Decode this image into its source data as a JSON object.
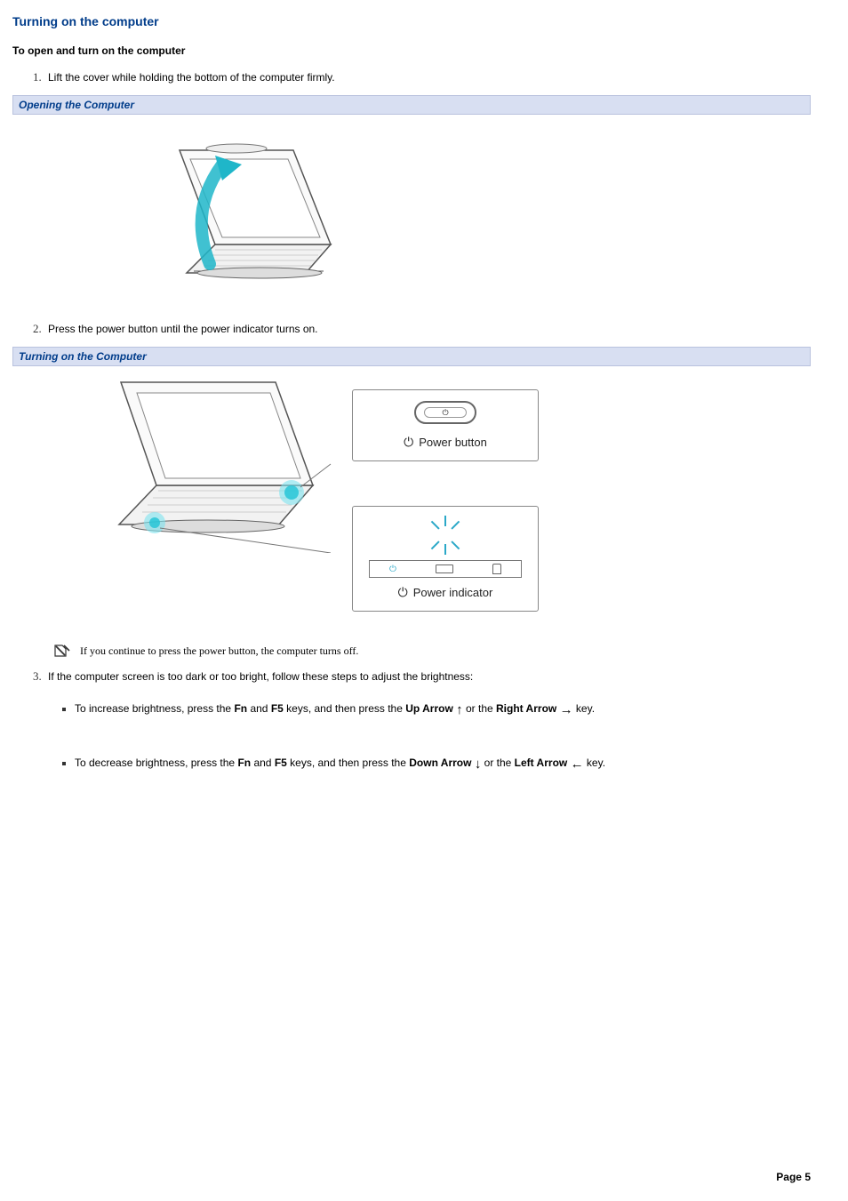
{
  "heading": "Turning on the computer",
  "subheading": "To open and turn on the computer",
  "steps": {
    "s1": "Lift the cover while holding the bottom of the computer firmly.",
    "s2": "Press the power button until the power indicator turns on.",
    "s3": "If the computer screen is too dark or too bright, follow these steps to adjust the brightness:"
  },
  "captions": {
    "open": "Opening the Computer",
    "turnon": "Turning on the Computer"
  },
  "callouts": {
    "power_button": "Power button",
    "power_indicator": "Power indicator"
  },
  "note": "If you continue to press the power button, the computer turns off.",
  "bullets": {
    "increase": {
      "pre": "To increase brightness, press the ",
      "fn": "Fn",
      "mid1": " and ",
      "f5": "F5",
      "mid2": " keys, and then press the ",
      "uparrow": "Up Arrow",
      "or": " or the ",
      "rightarrow": "Right Arrow",
      "post": " key."
    },
    "decrease": {
      "pre": "To decrease brightness, press the ",
      "fn": "Fn",
      "mid1": " and ",
      "f5": "F5",
      "mid2": " keys, and then press the ",
      "downarrow": "Down Arrow",
      "or": " or the ",
      "leftarrow": "Left Arrow",
      "post": " key."
    }
  },
  "footer": "Page 5",
  "glyphs": {
    "arrow_up": "↑",
    "arrow_right": "→",
    "arrow_down": "↓",
    "arrow_left": "←",
    "power": "⏻"
  }
}
